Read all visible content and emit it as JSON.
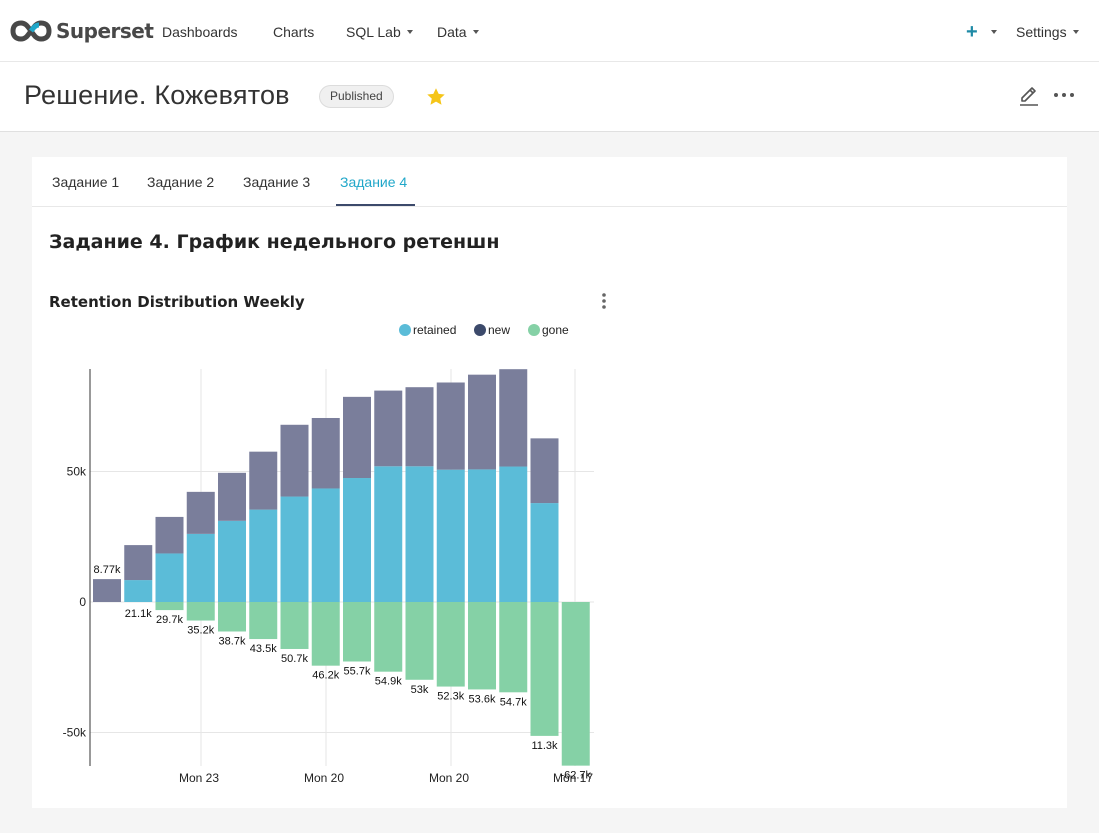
{
  "nav": {
    "brand": "Superset",
    "items": [
      "Dashboards",
      "Charts",
      "SQL Lab",
      "Data"
    ],
    "settings": "Settings"
  },
  "header": {
    "title": "Решение. Кожевятов",
    "status": "Published"
  },
  "tabs": [
    "Задание 1",
    "Задание 2",
    "Задание 3",
    "Задание 4"
  ],
  "active_tab": 3,
  "section": {
    "heading": "Задание 4. График недельного ретеншн"
  },
  "chart": {
    "title": "Retention Distribution Weekly"
  },
  "colors": {
    "retained": "#5bbcd8",
    "new": "#7a7e9b",
    "gone": "#85d1a6",
    "accent": "#20a7c9"
  },
  "chart_data": {
    "type": "bar",
    "stacked": true,
    "legend_position": "top",
    "grid": true,
    "ylim": [
      -62700,
      89200
    ],
    "yticks": [
      50000,
      0,
      -50000
    ],
    "ytick_labels": [
      "50k",
      "0",
      "-50k"
    ],
    "xtick_labels": [
      "Mon 23",
      "Mon 20",
      "Mon 20",
      "Mon 17"
    ],
    "series": [
      {
        "name": "retained",
        "values": [
          0,
          8400,
          18600,
          26100,
          31100,
          35400,
          40400,
          43500,
          47500,
          52000,
          52000,
          50700,
          50800,
          51900,
          37900,
          0
        ]
      },
      {
        "name": "new",
        "values": [
          8770,
          13400,
          14000,
          16100,
          18400,
          22200,
          27500,
          27000,
          31100,
          29000,
          30300,
          33400,
          36300,
          37300,
          24800,
          0
        ]
      },
      {
        "name": "gone",
        "values": [
          0,
          0,
          -3100,
          -7100,
          -11300,
          -14200,
          -18000,
          -24400,
          -22800,
          -26700,
          -29800,
          -32400,
          -33500,
          -34600,
          -51300,
          -62700
        ]
      }
    ],
    "data_labels": [
      "8.77k",
      "21.1k",
      "29.7k",
      "35.2k",
      "38.7k",
      "43.5k",
      "50.7k",
      "46.2k",
      "55.7k",
      "54.9k",
      "53k",
      "52.3k",
      "53.6k",
      "54.7k",
      "11.3k",
      "-62.7k"
    ]
  }
}
